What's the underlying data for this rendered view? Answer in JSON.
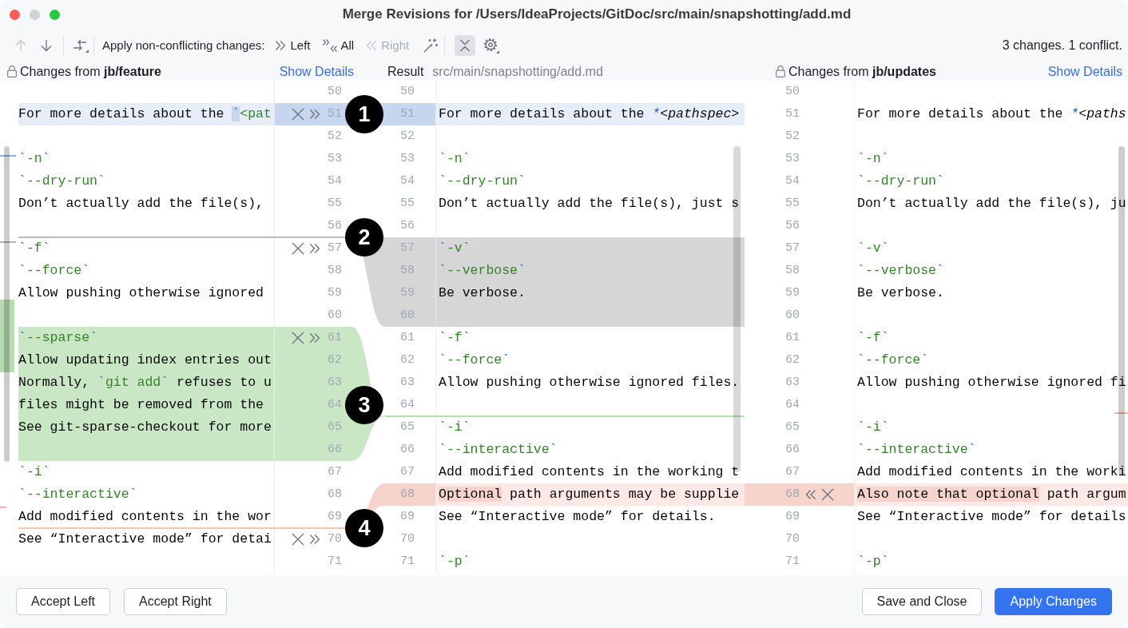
{
  "window": {
    "title": "Merge Revisions for /Users/IdeaProjects/GitDoc/src/main/snapshotting/add.md",
    "controls": [
      {
        "kind": "close",
        "disabled": false
      },
      {
        "kind": "minimize",
        "disabled": true
      },
      {
        "kind": "zoom",
        "disabled": false
      }
    ]
  },
  "toolbar": {
    "nav": [
      {
        "kind": "up",
        "disabled": true
      },
      {
        "kind": "down",
        "disabled": false
      },
      {
        "kind": "swap",
        "disabled": false
      }
    ],
    "apply_label": "Apply non-conflicting changes:",
    "apply_buttons": [
      {
        "kind": "left",
        "label": "Left",
        "disabled": false
      },
      {
        "kind": "all",
        "label": "All",
        "disabled": false
      },
      {
        "kind": "right",
        "label": "Right",
        "disabled": true
      }
    ],
    "tools": [
      {
        "kind": "wand",
        "on": false
      },
      {
        "kind": "collapse",
        "on": true
      },
      {
        "kind": "settings",
        "on": false
      }
    ],
    "summary": "3 changes. 1 conflict."
  },
  "left_pane": {
    "title": "Changes from **jb/feature**",
    "link": "Show Details",
    "lines": [
      {
        "n": "50",
        "kind": "none"
      },
      {
        "n": "51",
        "kind": "modified",
        "segments": [
          {
            "text": "For more details about the ",
            "changed": false
          },
          {
            "text": "`",
            "changed": true
          },
          {
            "text": "<pat",
            "changed": false
          }
        ],
        "actions": [
          {
            "kind": "ignore"
          },
          {
            "kind": "apply"
          }
        ],
        "badge": "1"
      },
      {
        "n": "52",
        "kind": "none"
      },
      {
        "n": "53",
        "kind": "none",
        "text": "`-n`"
      },
      {
        "n": "54",
        "kind": "none",
        "text": "`--dry-run`"
      },
      {
        "n": "55",
        "kind": "none",
        "text": "Don’t actually add the file(s),"
      },
      {
        "n": "56",
        "kind": "none",
        "insertion_below": {
          "kind": "deleted"
        },
        "badge": "2"
      },
      {
        "n": "57",
        "kind": "none",
        "text": "`-f`",
        "actions": [
          {
            "kind": "ignore"
          },
          {
            "kind": "apply"
          }
        ]
      },
      {
        "n": "58",
        "kind": "none",
        "text": "`--force`"
      },
      {
        "n": "59",
        "kind": "none",
        "text": "Allow pushing otherwise ignored"
      },
      {
        "n": "60",
        "kind": "none"
      },
      {
        "n": "61",
        "kind": "added",
        "text": "`--sparse`",
        "actions": [
          {
            "kind": "ignore"
          },
          {
            "kind": "apply"
          }
        ]
      },
      {
        "n": "62",
        "kind": "added",
        "text": "Allow updating index entries out"
      },
      {
        "n": "63",
        "kind": "added",
        "text": "Normally, `git add` refuses to u"
      },
      {
        "n": "64",
        "kind": "added",
        "text": "files might be removed from the",
        "badge": "3"
      },
      {
        "n": "65",
        "kind": "added",
        "text": "See git-sparse-checkout for more"
      },
      {
        "n": "66",
        "kind": "added"
      },
      {
        "n": "67",
        "kind": "none",
        "text": "`-i`"
      },
      {
        "n": "68",
        "kind": "none",
        "text": "`--interactive`"
      },
      {
        "n": "69",
        "kind": "none",
        "text": "Add modified contents in the wor",
        "insertion_below": {
          "kind": "conflict"
        },
        "badge": "4"
      },
      {
        "n": "70",
        "kind": "none",
        "text": "See “Interactive mode” for detai",
        "actions": [
          {
            "kind": "ignore"
          },
          {
            "kind": "apply"
          }
        ]
      },
      {
        "n": "71",
        "kind": "none"
      }
    ]
  },
  "result_pane": {
    "title": "Result",
    "path": "src/main/snapshotting/add.md",
    "lines": [
      {
        "n": "50",
        "kind": "none"
      },
      {
        "n": "51",
        "kind": "modified",
        "text": "For more details about the *<pathspec>"
      },
      {
        "n": "52",
        "kind": "none"
      },
      {
        "n": "53",
        "kind": "none",
        "text": "`-n`"
      },
      {
        "n": "54",
        "kind": "none",
        "text": "`--dry-run`"
      },
      {
        "n": "55",
        "kind": "none",
        "text": "Don’t actually add the file(s), just s"
      },
      {
        "n": "56",
        "kind": "none"
      },
      {
        "n": "57",
        "kind": "deleted",
        "text": "`-v`"
      },
      {
        "n": "58",
        "kind": "deleted",
        "text": "`--verbose`"
      },
      {
        "n": "59",
        "kind": "deleted",
        "text": "Be verbose."
      },
      {
        "n": "60",
        "kind": "deleted"
      },
      {
        "n": "61",
        "kind": "none",
        "text": "`-f`"
      },
      {
        "n": "62",
        "kind": "none",
        "text": "`--force`"
      },
      {
        "n": "63",
        "kind": "none",
        "text": "Allow pushing otherwise ignored files."
      },
      {
        "n": "64",
        "kind": "none",
        "insertion_below": {
          "kind": "added"
        }
      },
      {
        "n": "65",
        "kind": "none",
        "text": "`-i`"
      },
      {
        "n": "66",
        "kind": "none",
        "text": "`--interactive`"
      },
      {
        "n": "67",
        "kind": "none",
        "text": "Add modified contents in the working t"
      },
      {
        "n": "68",
        "kind": "conflict",
        "segments": [
          {
            "text": "Optional",
            "changed": true
          },
          {
            "text": " path arguments may be supplie",
            "changed": false
          }
        ]
      },
      {
        "n": "69",
        "kind": "none",
        "text": "See “Interactive mode” for details."
      },
      {
        "n": "70",
        "kind": "none"
      },
      {
        "n": "71",
        "kind": "none",
        "text": "`-p`"
      }
    ]
  },
  "right_pane": {
    "title": "Changes from **jb/updates**",
    "link": "Show Details",
    "lines": [
      {
        "n": "50",
        "kind": "none"
      },
      {
        "n": "51",
        "kind": "none",
        "text": "For more details about the *<paths"
      },
      {
        "n": "52",
        "kind": "none"
      },
      {
        "n": "53",
        "kind": "none",
        "text": "`-n`"
      },
      {
        "n": "54",
        "kind": "none",
        "text": "`--dry-run`"
      },
      {
        "n": "55",
        "kind": "none",
        "text": "Don’t actually add the file(s), ju"
      },
      {
        "n": "56",
        "kind": "none"
      },
      {
        "n": "57",
        "kind": "none",
        "text": "`-v`"
      },
      {
        "n": "58",
        "kind": "none",
        "text": "`--verbose`"
      },
      {
        "n": "59",
        "kind": "none",
        "text": "Be verbose."
      },
      {
        "n": "60",
        "kind": "none"
      },
      {
        "n": "61",
        "kind": "none",
        "text": "`-f`"
      },
      {
        "n": "62",
        "kind": "none",
        "text": "`--force`"
      },
      {
        "n": "63",
        "kind": "none",
        "text": "Allow pushing otherwise ignored fi"
      },
      {
        "n": "64",
        "kind": "none"
      },
      {
        "n": "65",
        "kind": "none",
        "text": "`-i`"
      },
      {
        "n": "66",
        "kind": "none",
        "text": "`--interactive`"
      },
      {
        "n": "67",
        "kind": "none",
        "text": "Add modified contents in the worki"
      },
      {
        "n": "68",
        "kind": "conflict",
        "segments": [
          {
            "text": "Also note that optional",
            "changed": true
          },
          {
            "text": " path argum",
            "changed": false
          }
        ],
        "actions": [
          {
            "kind": "apply"
          },
          {
            "kind": "ignore"
          }
        ]
      },
      {
        "n": "69",
        "kind": "none",
        "text": "See “Interactive mode” for details"
      },
      {
        "n": "70",
        "kind": "none"
      },
      {
        "n": "71",
        "kind": "none",
        "text": "`-p`"
      }
    ]
  },
  "footer": {
    "left_buttons": [
      {
        "label": "Accept Left",
        "primary": false
      },
      {
        "label": "Accept Right",
        "primary": false
      }
    ],
    "right_buttons": [
      {
        "label": "Save and Close",
        "primary": false
      },
      {
        "label": "Apply Changes",
        "primary": true
      }
    ]
  }
}
